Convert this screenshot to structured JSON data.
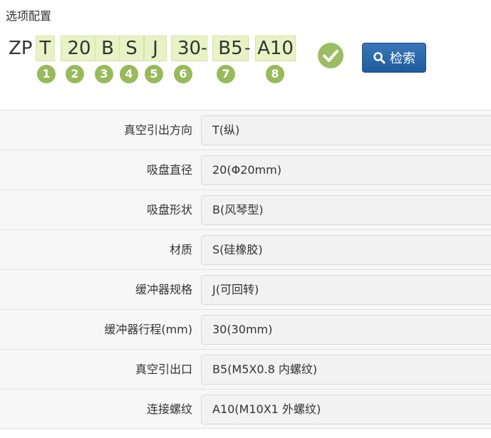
{
  "section_title": "选项配置",
  "code": {
    "prefix": "ZP",
    "segments": [
      "T",
      "20",
      "B",
      "S",
      "J",
      "30",
      "B5",
      "A10"
    ],
    "separator": "-",
    "numbers": [
      "1",
      "2",
      "3",
      "4",
      "5",
      "6",
      "7",
      "8"
    ],
    "segment_bg_color": "#e9f2c4",
    "number_badge_color": "#98ba5c"
  },
  "confirm_icon": "check-circle-icon",
  "search_button": {
    "label": "检索",
    "icon": "search-icon",
    "color": "#2a69a8"
  },
  "options": [
    {
      "label": "真空引出方向",
      "value": "T(纵)"
    },
    {
      "label": "吸盘直径",
      "value": "20(Φ20mm)"
    },
    {
      "label": "吸盘形状",
      "value": "B(风琴型)"
    },
    {
      "label": "材质",
      "value": "S(硅橡胶)"
    },
    {
      "label": "缓冲器规格",
      "value": "J(可回转)"
    },
    {
      "label": "缓冲器行程(mm)",
      "value": "30(30mm)"
    },
    {
      "label": "真空引出口",
      "value": "B5(M5X0.8 内螺纹)"
    },
    {
      "label": "连接螺纹",
      "value": "A10(M10X1 外螺纹)"
    }
  ]
}
